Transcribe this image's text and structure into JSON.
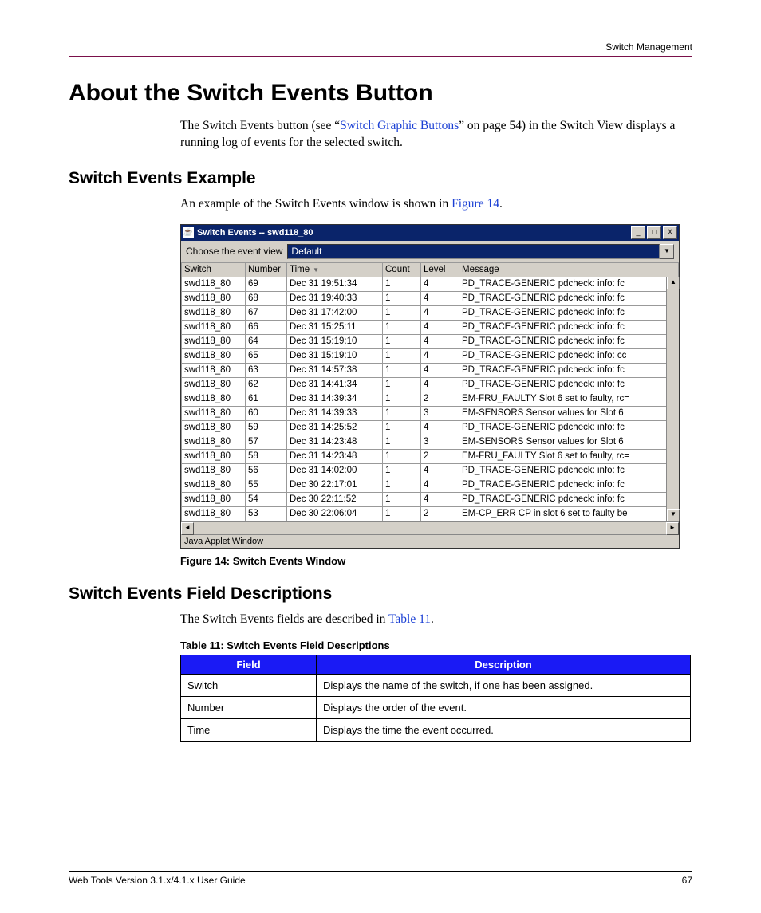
{
  "running_head": "Switch Management",
  "h1": "About the Switch Events Button",
  "intro_pre": "The Switch Events button (see “",
  "intro_link": "Switch Graphic Buttons",
  "intro_post": "” on page 54) in the Switch View displays a running log of events for the selected switch.",
  "h2_example": "Switch Events Example",
  "example_pre": "An example of the Switch Events window is shown in ",
  "example_link": "Figure 14",
  "example_post": ".",
  "window": {
    "title": "Switch Events -- swd118_80",
    "chooser_label": "Choose the event view",
    "chooser_value": "Default",
    "cols": {
      "switch_w": "80",
      "number_w": "52",
      "time_w": "120",
      "count_w": "48",
      "level_w": "48",
      "message_w": "auto"
    },
    "headers": [
      "Switch",
      "Number",
      "Time",
      "Count",
      "Level",
      "Message"
    ],
    "sort_arrow": "▼",
    "rows": [
      {
        "s": "swd118_80",
        "n": "69",
        "t": "Dec 31 19:51:34",
        "c": "1",
        "l": "4",
        "m": "PD_TRACE-GENERIC   pdcheck: info: fc"
      },
      {
        "s": "swd118_80",
        "n": "68",
        "t": "Dec 31 19:40:33",
        "c": "1",
        "l": "4",
        "m": "PD_TRACE-GENERIC   pdcheck: info: fc"
      },
      {
        "s": "swd118_80",
        "n": "67",
        "t": "Dec 31 17:42:00",
        "c": "1",
        "l": "4",
        "m": "PD_TRACE-GENERIC   pdcheck: info: fc"
      },
      {
        "s": "swd118_80",
        "n": "66",
        "t": "Dec 31 15:25:11",
        "c": "1",
        "l": "4",
        "m": "PD_TRACE-GENERIC   pdcheck: info: fc"
      },
      {
        "s": "swd118_80",
        "n": "64",
        "t": "Dec 31 15:19:10",
        "c": "1",
        "l": "4",
        "m": "PD_TRACE-GENERIC   pdcheck: info: fc"
      },
      {
        "s": "swd118_80",
        "n": "65",
        "t": "Dec 31 15:19:10",
        "c": "1",
        "l": "4",
        "m": "PD_TRACE-GENERIC   pdcheck: info: cc"
      },
      {
        "s": "swd118_80",
        "n": "63",
        "t": "Dec 31 14:57:38",
        "c": "1",
        "l": "4",
        "m": "PD_TRACE-GENERIC   pdcheck: info: fc"
      },
      {
        "s": "swd118_80",
        "n": "62",
        "t": "Dec 31 14:41:34",
        "c": "1",
        "l": "4",
        "m": "PD_TRACE-GENERIC   pdcheck: info: fc"
      },
      {
        "s": "swd118_80",
        "n": "61",
        "t": "Dec 31 14:39:34",
        "c": "1",
        "l": "2",
        "m": "EM-FRU_FAULTY Slot 6 set to faulty, rc="
      },
      {
        "s": "swd118_80",
        "n": "60",
        "t": "Dec 31 14:39:33",
        "c": "1",
        "l": "3",
        "m": "EM-SENSORS Sensor values for Slot 6"
      },
      {
        "s": "swd118_80",
        "n": "59",
        "t": "Dec 31 14:25:52",
        "c": "1",
        "l": "4",
        "m": "PD_TRACE-GENERIC   pdcheck: info: fc"
      },
      {
        "s": "swd118_80",
        "n": "57",
        "t": "Dec 31 14:23:48",
        "c": "1",
        "l": "3",
        "m": "EM-SENSORS Sensor values for Slot 6"
      },
      {
        "s": "swd118_80",
        "n": "58",
        "t": "Dec 31 14:23:48",
        "c": "1",
        "l": "2",
        "m": "EM-FRU_FAULTY Slot 6 set to faulty, rc="
      },
      {
        "s": "swd118_80",
        "n": "56",
        "t": "Dec 31 14:02:00",
        "c": "1",
        "l": "4",
        "m": "PD_TRACE-GENERIC   pdcheck: info: fc"
      },
      {
        "s": "swd118_80",
        "n": "55",
        "t": "Dec 30 22:17:01",
        "c": "1",
        "l": "4",
        "m": "PD_TRACE-GENERIC   pdcheck: info: fc"
      },
      {
        "s": "swd118_80",
        "n": "54",
        "t": "Dec 30 22:11:52",
        "c": "1",
        "l": "4",
        "m": "PD_TRACE-GENERIC   pdcheck: info: fc"
      },
      {
        "s": "swd118_80",
        "n": "53",
        "t": "Dec 30 22:06:04",
        "c": "1",
        "l": "2",
        "m": "EM-CP_ERR CP in slot 6 set to faulty be"
      }
    ],
    "status": "Java Applet Window"
  },
  "fig_caption": "Figure 14:  Switch Events Window",
  "h2_fields": "Switch Events Field Descriptions",
  "fields_pre": "The Switch Events fields are described in ",
  "fields_link": "Table 11",
  "fields_post": ".",
  "tbl_caption": "Table 11:  Switch Events Field Descriptions",
  "fdesc": {
    "headers": [
      "Field",
      "Description"
    ],
    "rows": [
      {
        "f": "Switch",
        "d": "Displays the name of the switch, if one has been assigned."
      },
      {
        "f": "Number",
        "d": "Displays the order of the event."
      },
      {
        "f": "Time",
        "d": "Displays the time the event occurred."
      }
    ]
  },
  "footer_left": "Web Tools Version 3.1.x/4.1.x User Guide",
  "footer_right": "67"
}
